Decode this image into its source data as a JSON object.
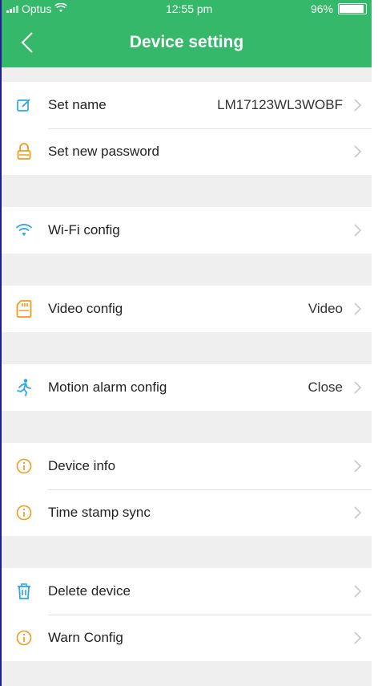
{
  "status": {
    "carrier": "Optus",
    "time": "12:55 pm",
    "battery": "96%"
  },
  "nav": {
    "title": "Device setting"
  },
  "colors": {
    "accent": "#35b86a",
    "icon_blue": "#2aa7e8",
    "icon_orange": "#f39a1b"
  },
  "groups": [
    {
      "items": [
        {
          "label": "Set name",
          "value": "LM17123WL3WOBF",
          "icon": "edit-icon"
        },
        {
          "label": "Set new password",
          "value": "",
          "icon": "lock-icon"
        }
      ]
    },
    {
      "items": [
        {
          "label": "Wi-Fi config",
          "value": "",
          "icon": "wifi-icon"
        }
      ]
    },
    {
      "items": [
        {
          "label": "Video config",
          "value": "Video",
          "icon": "sd-card-icon"
        }
      ]
    },
    {
      "items": [
        {
          "label": "Motion alarm config",
          "value": "Close",
          "icon": "running-person-icon"
        }
      ]
    },
    {
      "items": [
        {
          "label": "Device info",
          "value": "",
          "icon": "info-icon"
        },
        {
          "label": "Time stamp sync",
          "value": "",
          "icon": "info-icon"
        }
      ]
    },
    {
      "items": [
        {
          "label": "Delete device",
          "value": "",
          "icon": "trash-icon"
        },
        {
          "label": "Warn Config",
          "value": "",
          "icon": "info-icon"
        }
      ]
    }
  ]
}
